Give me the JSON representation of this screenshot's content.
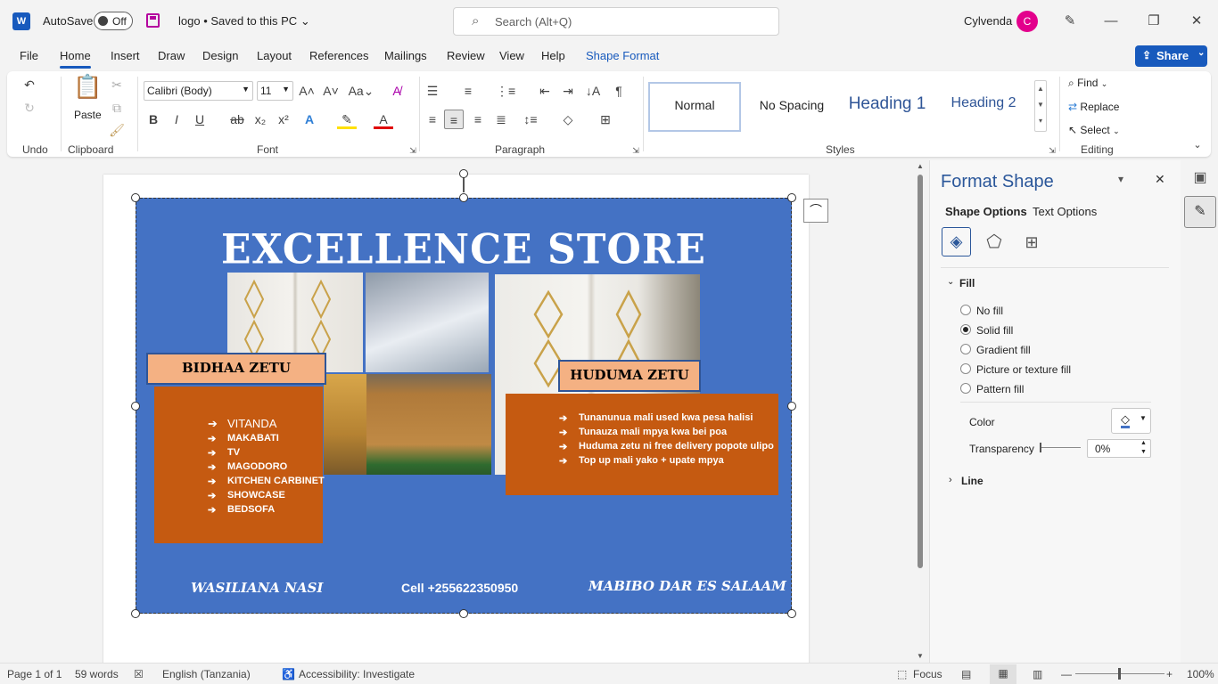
{
  "titlebar": {
    "autosave_label": "AutoSave",
    "autosave_state": "Off",
    "doc_title": "logo • Saved to this PC",
    "search_placeholder": "Search (Alt+Q)",
    "user_name": "Cylvenda",
    "user_initial": "C"
  },
  "menu": {
    "tabs": [
      "File",
      "Home",
      "Insert",
      "Draw",
      "Design",
      "Layout",
      "References",
      "Mailings",
      "Review",
      "View",
      "Help",
      "Shape Format"
    ],
    "active": "Home",
    "share_label": "Share"
  },
  "ribbon": {
    "groups": {
      "undo": "Undo",
      "clipboard": "Clipboard",
      "font": "Font",
      "paragraph": "Paragraph",
      "styles": "Styles",
      "editing": "Editing"
    },
    "paste_label": "Paste",
    "font_name": "Calibri (Body)",
    "font_size": "11",
    "styles": [
      "Normal",
      "No Spacing",
      "Heading 1",
      "Heading 2"
    ],
    "find_label": "Find",
    "replace_label": "Replace",
    "select_label": "Select"
  },
  "flyer": {
    "title": "EXCELLENCE STORE",
    "left_label": "BIDHAA ZETU",
    "left_items": [
      "VITANDA",
      "MAKABATI",
      "TV",
      "MAGODORO",
      "KITCHEN CARBINET",
      "SHOWCASE",
      "BEDSOFA"
    ],
    "right_label": "HUDUMA ZETU",
    "right_items": [
      "Tunanunua mali used kwa pesa halisi",
      "Tunauza mali mpya kwa bei poa",
      "Huduma zetu ni free delivery popote ulipo",
      "Top up mali yako  + upate mpya"
    ],
    "footer_left": "WASILIANA NASI",
    "footer_center": "Cell +255622350950",
    "footer_right": "MABIBO DAR ES SALAAM",
    "colors": {
      "background": "#4472c4",
      "orange": "#c55a11",
      "label": "#f4b183"
    }
  },
  "pane": {
    "title": "Format Shape",
    "tabs": [
      "Shape Options",
      "Text Options"
    ],
    "fill_heading": "Fill",
    "fill_options": [
      "No fill",
      "Solid fill",
      "Gradient fill",
      "Picture or texture fill",
      "Pattern fill"
    ],
    "fill_selected": "Solid fill",
    "color_label": "Color",
    "transparency_label": "Transparency",
    "transparency_value": "0%",
    "line_heading": "Line"
  },
  "status": {
    "page": "Page 1 of 1",
    "words": "59 words",
    "language": "English (Tanzania)",
    "accessibility": "Accessibility: Investigate",
    "focus": "Focus",
    "zoom": "100%"
  }
}
